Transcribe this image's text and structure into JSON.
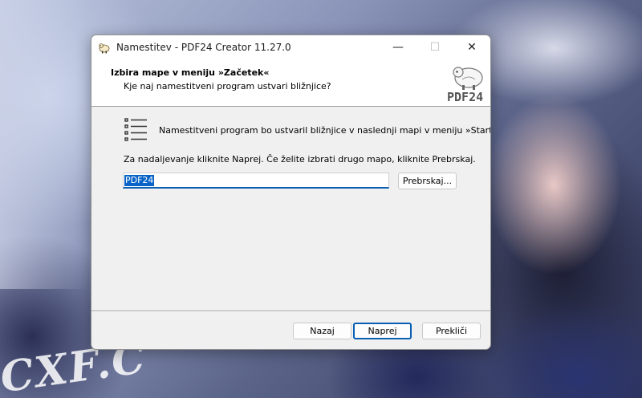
{
  "window": {
    "title": "Namestitev - PDF24 Creator 11.27.0",
    "controls": {
      "minimize": "—",
      "maximize": "☐",
      "close": "✕"
    }
  },
  "header": {
    "title": "Izbira mape v meniju »Začetek«",
    "subtitle": "Kje naj namestitveni program ustvari bližnjice?",
    "logo_text": "PDF24"
  },
  "body": {
    "info_text": "Namestitveni program bo ustvaril bližnjice v naslednji mapi v meniju »Start«.",
    "continue_text": "Za nadaljevanje kliknite Naprej. Če želite izbrati drugo mapo, kliknite Prebrskaj.",
    "folder_value": "PDF24",
    "browse_label": "Prebrskaj..."
  },
  "footer": {
    "back_label": "Nazaj",
    "next_label": "Naprej",
    "cancel_label": "Prekliči"
  },
  "desktop": {
    "watermark": "CXF.C"
  },
  "colors": {
    "accent": "#0a5fb4",
    "selection": "#0a64c8",
    "dialog_bg": "#f0f0f0"
  }
}
